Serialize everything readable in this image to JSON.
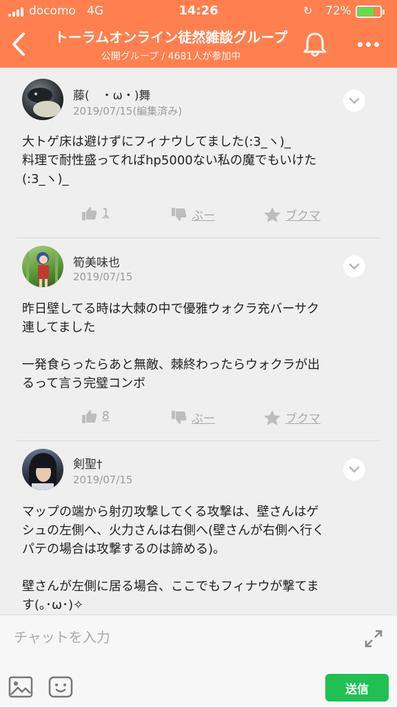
{
  "status_bar": {
    "carrier": "docomo",
    "network": "4G",
    "time": "14:26",
    "battery_percent": "72%",
    "battery_level": 0.72,
    "icons": [
      "signal-icon",
      "orientation-lock-icon",
      "battery-icon"
    ]
  },
  "header": {
    "title": "トーラムオンライン徒然雑談グループ",
    "subtitle": "公開グループ / 4681人が参加中",
    "back_icon": "chevron-left-icon",
    "bell_icon": "bell-icon",
    "more_icon": "more-dots-icon"
  },
  "posts": [
    {
      "user": "藤(　・ω・)舞",
      "date": "2019/07/15(編集済み)",
      "lines": [
        "大トゲ床は避けずにフィナウしてました(:3_ヽ)_",
        "料理で耐性盛ってればhp5000ない私の魔でもいけた",
        "(:3_ヽ)_"
      ],
      "like_count": "1",
      "boo_label": "ぶー",
      "bookmark_label": "ブクマ"
    },
    {
      "user": "筍美味也",
      "date": "2019/07/15",
      "lines": [
        "昨日壁してる時は大棘の中で優雅ウォクラ充バーサク",
        "連してました",
        "",
        "一発食らったらあと無敵、棘終わったらウォクラが出",
        "るって言う完璧コンボ"
      ],
      "like_count": "8",
      "boo_label": "ぶー",
      "bookmark_label": "ブクマ"
    },
    {
      "user": "剣聖†",
      "date": "2019/07/15",
      "lines": [
        "マップの端から射刃攻撃してくる攻撃は、壁さんはゲ",
        "シュの左側へ、火力さんは右側へ(壁さんが右側へ行く",
        "パテの場合は攻撃するのは諦める)。",
        "",
        "壁さんが左側に居る場合、ここでもフィナウが撃てま",
        "す(｡･ω･)✧"
      ]
    }
  ],
  "composer": {
    "placeholder": "チャットを入力",
    "send_label": "送信"
  },
  "colors": {
    "header": "#ff7f4f",
    "send": "#1fc152",
    "battery": "#5ee04b"
  }
}
